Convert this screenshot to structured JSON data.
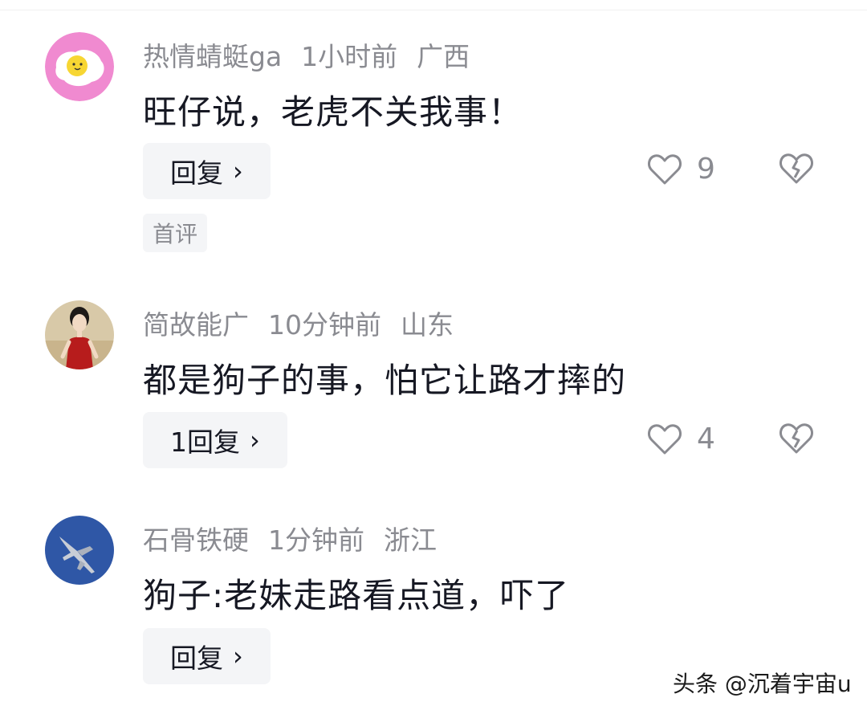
{
  "comments": [
    {
      "username": "热情蜻蜓ga",
      "time": "1小时前",
      "location": "广西",
      "text": "旺仔说，老虎不关我事！",
      "reply_label": "回复",
      "like_count": "9",
      "tag": "首评",
      "avatar": "fried-egg-avatar"
    },
    {
      "username": "简故能广",
      "time": "10分钟前",
      "location": "山东",
      "text": "都是狗子的事，怕它让路才摔的",
      "reply_label": "1回复",
      "like_count": "4",
      "avatar": "woman-red-dress-avatar"
    },
    {
      "username": "石骨铁硬",
      "time": "1分钟前",
      "location": "浙江",
      "text": "狗子:老妹走路看点道，吓了",
      "reply_label": "回复",
      "avatar": "fighter-jet-avatar"
    }
  ],
  "watermark": "头条 @沉着宇宙u",
  "colors": {
    "meta_gray": "#8a8b91",
    "button_bg": "#f4f5f7",
    "text": "#161823"
  }
}
